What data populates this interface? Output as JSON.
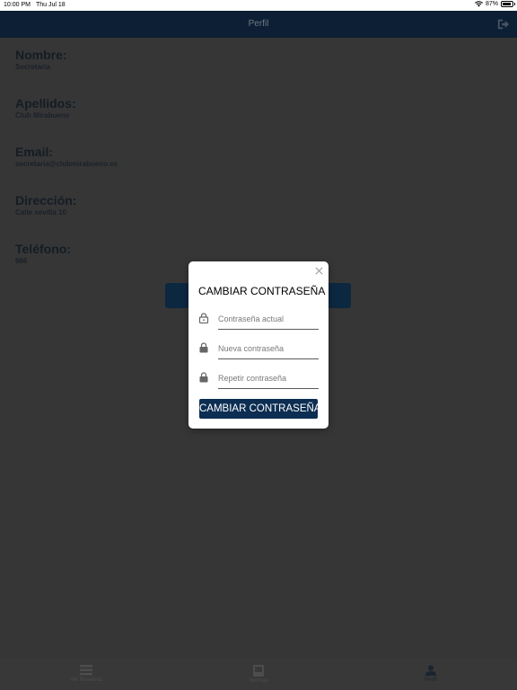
{
  "status_bar": {
    "time": "10:00 PM",
    "date": "Thu Jul 18",
    "battery": "87%"
  },
  "app_bar": {
    "title": "Perfil"
  },
  "profile": {
    "fields": [
      {
        "label": "Nombre:",
        "value": "Secretaria"
      },
      {
        "label": "Apellidos:",
        "value": "Club Mirabueno"
      },
      {
        "label": "Email:",
        "value": "secretaria@clubmirabueno.es"
      },
      {
        "label": "Dirección:",
        "value": "Calle sevilla 10"
      },
      {
        "label": "Teléfono:",
        "value": "666"
      }
    ]
  },
  "bottom_nav": {
    "tabs": [
      {
        "label": "Ver Reservas",
        "icon": "list-icon",
        "active": false
      },
      {
        "label": "Normas",
        "icon": "book-icon",
        "active": false
      },
      {
        "label": "Perfil",
        "icon": "person-icon",
        "active": true
      }
    ]
  },
  "modal": {
    "title": "CAMBIAR CONTRASEÑA",
    "current_password_placeholder": "Contraseña actual",
    "new_password_placeholder": "Nueva contraseña",
    "repeat_password_placeholder": "Repetir contraseña",
    "submit_label": "CAMBIAR CONTRASEÑA"
  },
  "colors": {
    "app_bar": "#0c1f34",
    "button": "#0c2e52",
    "overlay": "#363636"
  }
}
